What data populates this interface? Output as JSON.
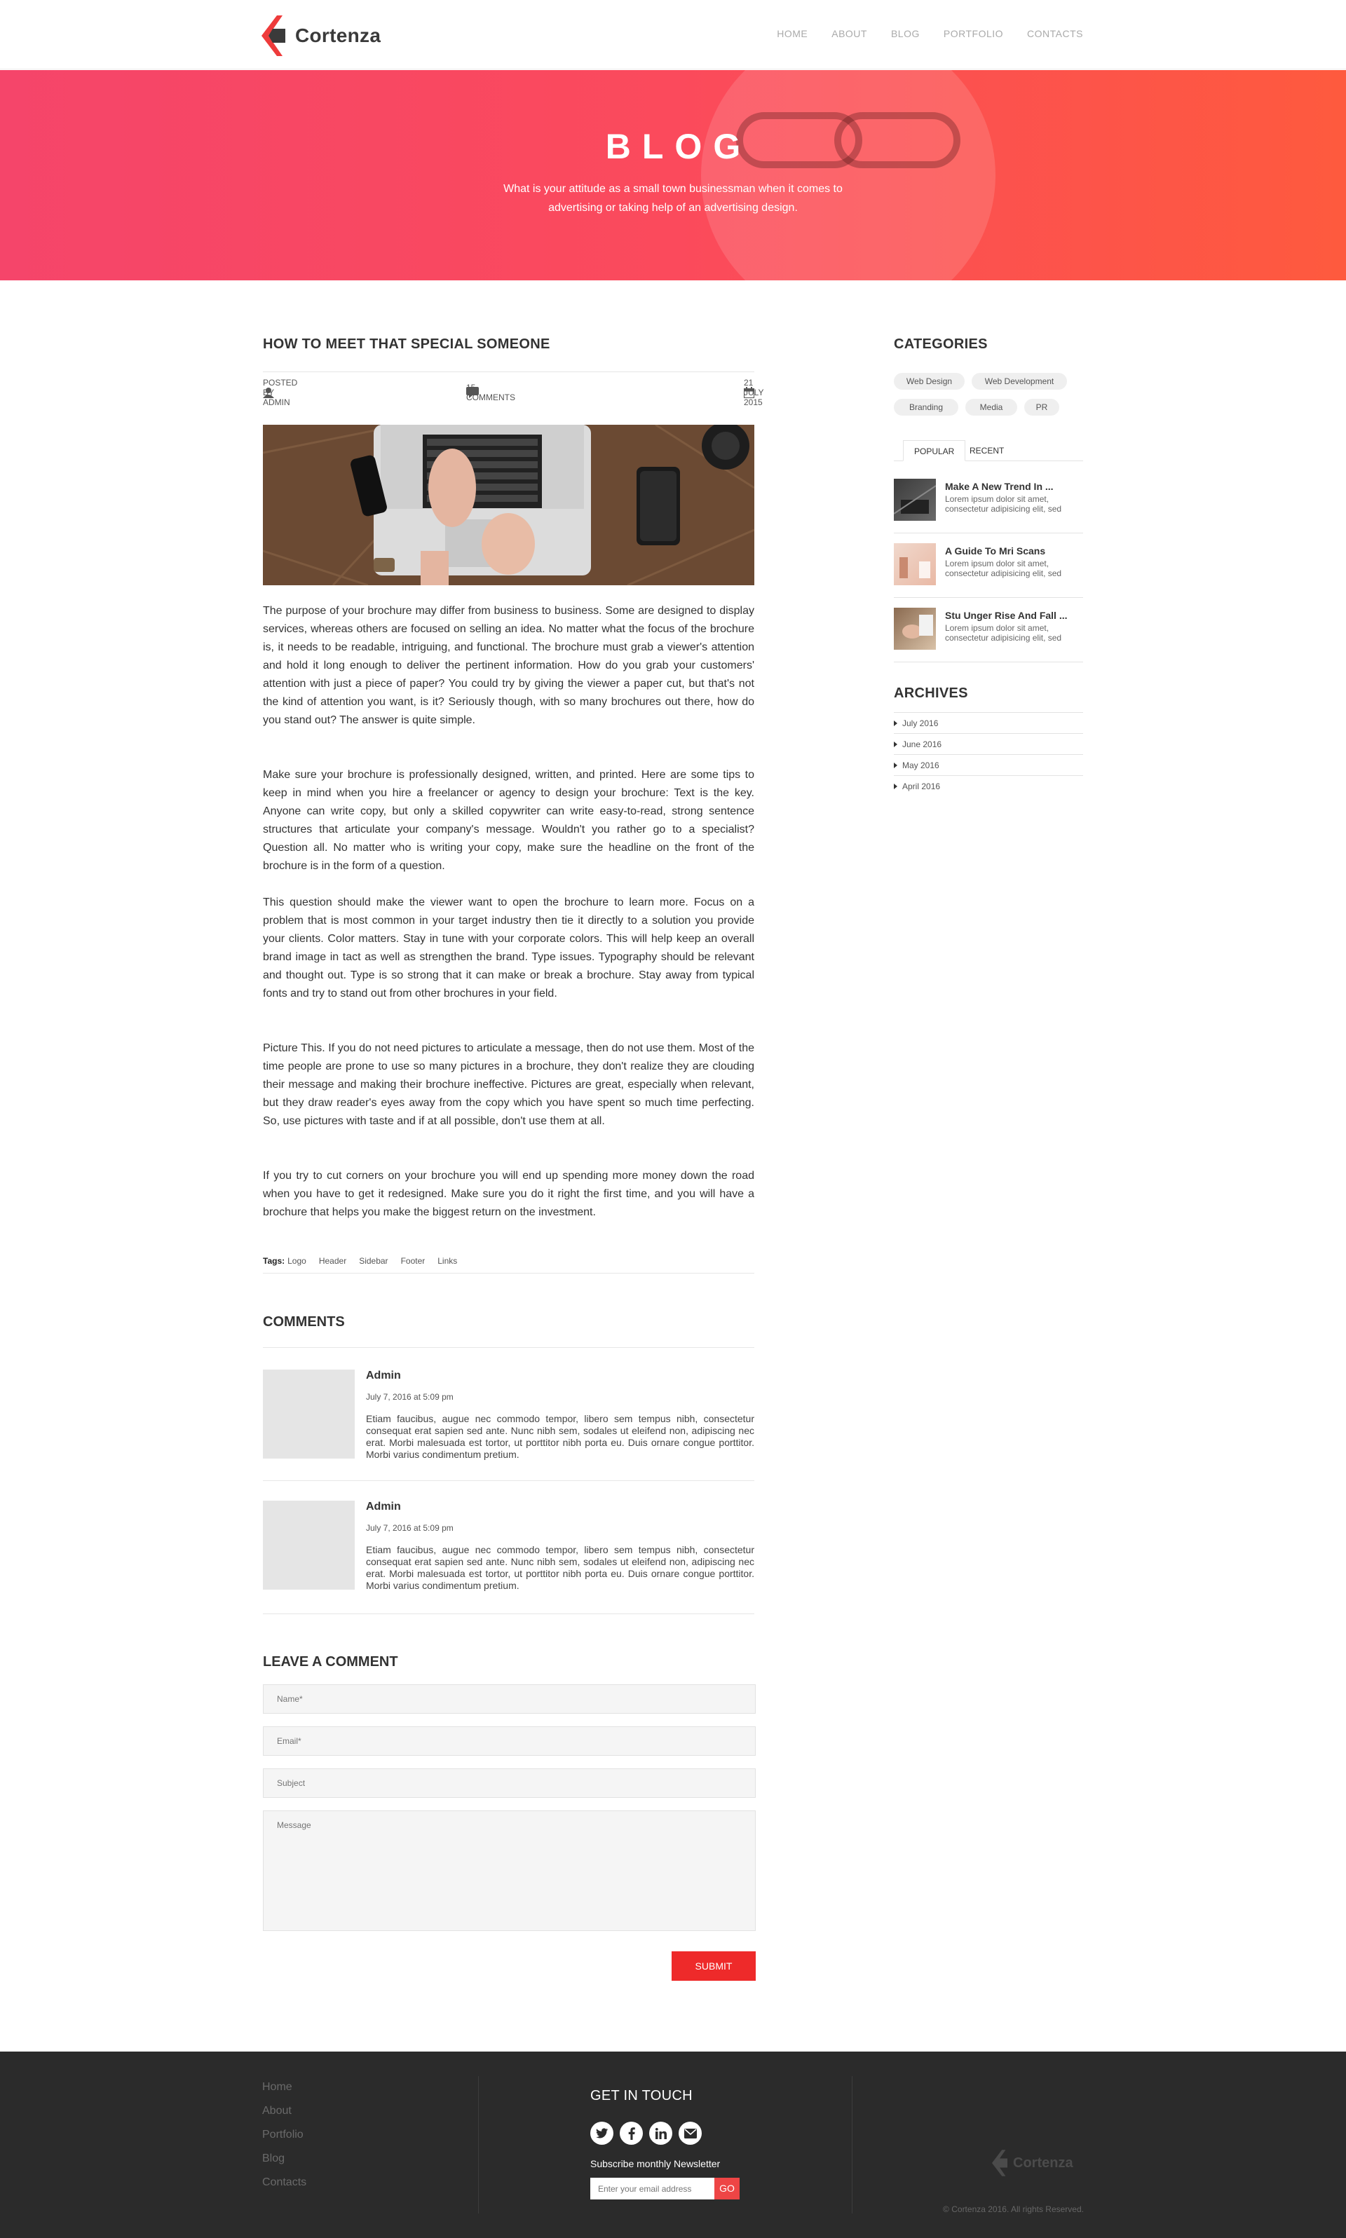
{
  "header": {
    "logo_text": "Cortenza",
    "nav": [
      "HOME",
      "ABOUT",
      "BLOG",
      "PORTFOLIO",
      "CONTACTS"
    ]
  },
  "hero": {
    "title": "BLOG",
    "subtitle": "What is your attitude as a small town businessman when it comes to advertising or taking help of an advertising design."
  },
  "post": {
    "title": "HOW TO MEET THAT SPECIAL SOMEONE",
    "author": "POSTED BY ADMIN",
    "comments": "15 COMMENTS",
    "date": "21 JULY 2015",
    "paragraphs": [
      "The purpose of your brochure may differ from business to business. Some are designed to display services, whereas others are focused on selling an idea. No matter what the focus of the brochure is, it needs to be readable, intriguing, and functional. The brochure must grab a viewer's attention and hold it long enough to deliver the pertinent information. How do you grab your customers' attention with just a piece of paper? You could try by giving the viewer a paper cut, but that's not the kind of attention you want, is it? Seriously though, with so many brochures out there, how do you stand out? The answer is quite simple.",
      "Make sure your brochure is professionally designed, written, and printed. Here are some tips to keep in mind when you hire a freelancer or agency to design your brochure: Text is the key. Anyone can write copy, but only a skilled copywriter can write easy-to-read, strong sentence structures that articulate your company's message. Wouldn't you rather go to a specialist? Question all. No matter who is writing your copy, make sure the headline on the front of the brochure is in the form of a question.",
      "This question should make the viewer want to open the brochure to learn more. Focus on a problem that is most common in your target industry then tie it directly to a solution you provide your clients. Color matters. Stay in tune with your corporate colors. This will help keep an overall brand image in tact as well as strengthen the brand. Type issues. Typography should be relevant and thought out. Type is so strong that it can make or break a brochure. Stay away from typical fonts and try to stand out from other brochures in your field.",
      "Picture This. If you do not need pictures to articulate a message, then do not use them. Most of the time people are prone to use so many pictures in a brochure, they don't realize they are clouding their message and making their brochure ineffective. Pictures are great, especially when relevant, but they draw reader's eyes away from the copy which you have spent so much time perfecting. So, use pictures with taste and if at all possible, don't use them at all.",
      "If you try to cut corners on your brochure you will end up spending more money down the road when you have to get it redesigned. Make sure you do it right the first time, and you will have a brochure that helps you make the biggest return on the investment."
    ],
    "tags_label": "Tags:",
    "tags": [
      "Logo",
      "Header",
      "Sidebar",
      "Footer",
      "Links"
    ]
  },
  "comments": {
    "title": "COMMENTS",
    "items": [
      {
        "name": "Admin",
        "date": "July 7, 2016 at 5:09 pm",
        "text": "Etiam faucibus, augue nec commodo tempor, libero sem tempus nibh, consectetur consequat erat sapien sed ante. Nunc nibh sem, sodales ut eleifend non, adipiscing nec erat. Morbi malesuada est tortor, ut porttitor nibh porta eu. Duis ornare congue porttitor. Morbi varius condimentum pretium."
      },
      {
        "name": "Admin",
        "date": "July 7, 2016 at 5:09 pm",
        "text": "Etiam faucibus, augue nec commodo tempor, libero sem tempus nibh, consectetur consequat erat sapien sed ante. Nunc nibh sem, sodales ut eleifend non, adipiscing nec erat. Morbi malesuada est tortor, ut porttitor nibh porta eu. Duis ornare congue porttitor. Morbi varius condimentum pretium."
      }
    ]
  },
  "form": {
    "title": "LEAVE A COMMENT",
    "name_placeholder": "Name*",
    "email_placeholder": "Email*",
    "subject_placeholder": "Subject",
    "message_placeholder": "Message",
    "submit": "SUBMIT"
  },
  "sidebar": {
    "categories_title": "CATEGORIES",
    "categories": [
      "Web Design",
      "Web Development",
      "Branding",
      "Media",
      "PR"
    ],
    "tabs": [
      "POPULAR",
      "RECENT"
    ],
    "posts": [
      {
        "title": "Make A New Trend In ...",
        "text": "Lorem ipsum dolor sit amet, consectetur adipisicing elit, sed"
      },
      {
        "title": "A Guide To Mri Scans",
        "text": "Lorem ipsum dolor sit amet, consectetur adipisicing elit, sed"
      },
      {
        "title": "Stu Unger Rise And Fall ...",
        "text": "Lorem ipsum dolor sit amet, consectetur adipisicing elit, sed"
      }
    ],
    "archives_title": "ARCHIVES",
    "archives": [
      "July 2016",
      "June 2016",
      "May 2016",
      "April 2016"
    ]
  },
  "footer": {
    "links": [
      "Home",
      "About",
      "Portfolio",
      "Blog",
      "Contacts"
    ],
    "get_in_touch": "GET IN TOUCH",
    "social": [
      "twitter-icon",
      "facebook-icon",
      "linkedin-icon",
      "mail-icon"
    ],
    "newsletter_label": "Subscribe monthly Newsletter",
    "email_placeholder": "Enter your email address",
    "go": "GO",
    "logo_text": "Cortenza",
    "copyright": "© Cortenza 2016. All rights Reserved."
  },
  "colors": {
    "accent": "#ee2a2a",
    "hero_start": "#f5456a",
    "hero_end": "#fe5a3e",
    "footer_bg": "#2b2b2b"
  }
}
